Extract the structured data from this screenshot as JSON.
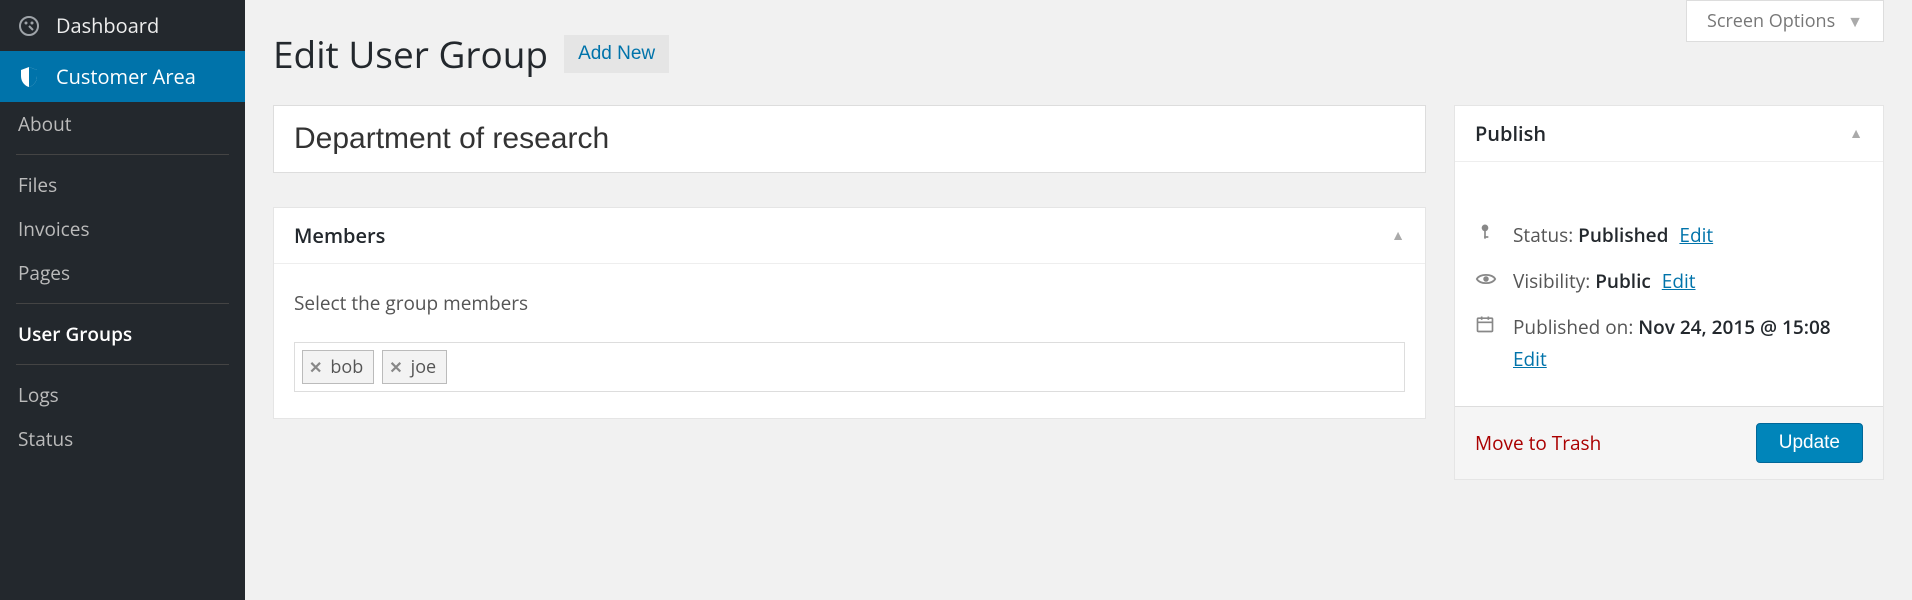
{
  "sidebar": {
    "items": [
      {
        "label": "Dashboard"
      },
      {
        "label": "Customer Area"
      }
    ],
    "subs": [
      {
        "label": "About"
      },
      {
        "label": "Files"
      },
      {
        "label": "Invoices"
      },
      {
        "label": "Pages"
      },
      {
        "label": "User Groups"
      },
      {
        "label": "Logs"
      },
      {
        "label": "Status"
      }
    ]
  },
  "header": {
    "title": "Edit User Group",
    "add_new": "Add New",
    "screen_options": "Screen Options"
  },
  "post": {
    "title_value": "Department of research"
  },
  "members_box": {
    "title": "Members",
    "label": "Select the group members",
    "tags": [
      "bob",
      "joe"
    ]
  },
  "publish_box": {
    "title": "Publish",
    "status_label": "Status:",
    "status_value": "Published",
    "visibility_label": "Visibility:",
    "visibility_value": "Public",
    "pubdate_label": "Published on:",
    "pubdate_value": "Nov 24, 2015 @ 15:08",
    "edit": "Edit",
    "trash": "Move to Trash",
    "update": "Update"
  }
}
